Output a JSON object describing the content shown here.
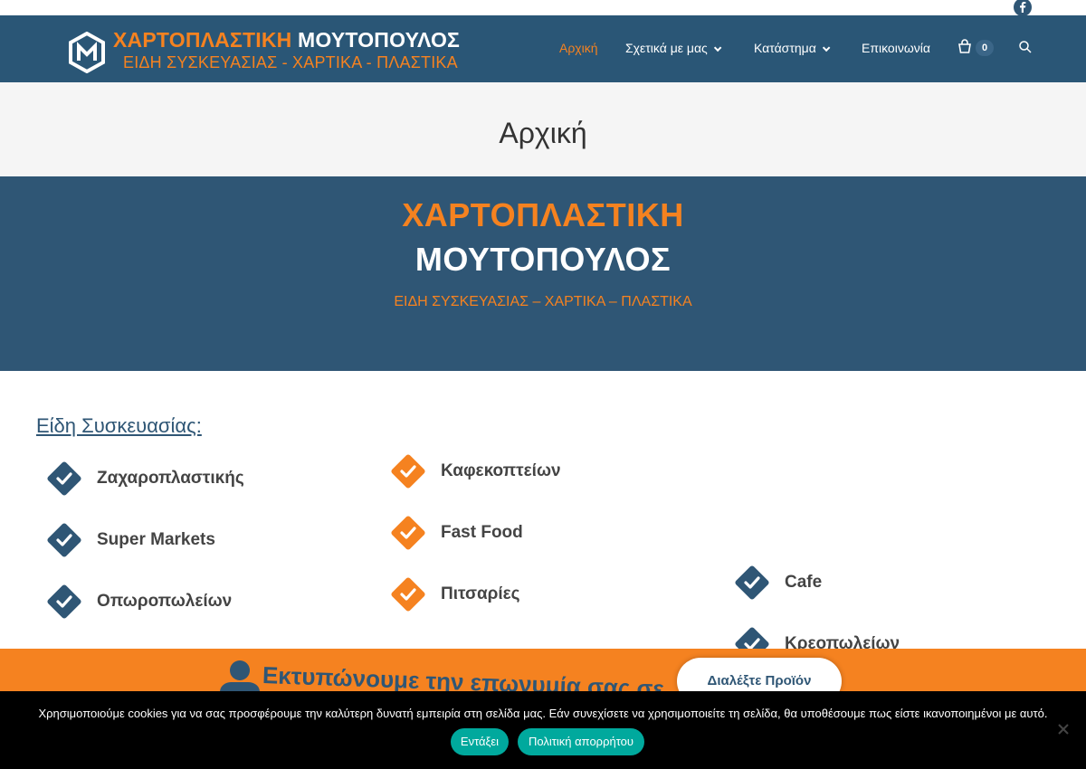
{
  "brand": {
    "name_orange": "ΧΑΡΤΟΠΛΑΣΤΙΚΗ",
    "name_white": "ΜΟΥΤΟΠΟΥΛΟΣ",
    "tagline": "ΕΙΔΗ ΣΥΣΚΕΥΑΣΙΑΣ - ΧΑΡΤΙΚΑ - ΠΛΑΣΤΙΚΑ"
  },
  "nav": {
    "home": "Αρχική",
    "about": "Σχετικά με μας",
    "shop": "Κατάστημα",
    "contact": "Επικοινωνία",
    "cart_count": "0"
  },
  "page_title": "Αρχική",
  "hero": {
    "line1": "ΧΑΡΤΟΠΛΑΣΤΙΚΗ",
    "line2": "ΜΟΥΤΟΠΟΥΛΟΣ",
    "subtitle": "ΕΙΔΗ ΣΥΣΚΕΥΑΣΙΑΣ – ΧΑΡΤΙΚΑ – ΠΛΑΣΤΙΚΑ"
  },
  "section": {
    "title": "Είδη Συσκευασίας:",
    "items": [
      {
        "label": "Ζαχαροπλαστικής",
        "color": "#2f5675"
      },
      {
        "label": "Super Markets",
        "color": "#2f5675"
      },
      {
        "label": "Οπωροπωλείων",
        "color": "#2f5675"
      },
      {
        "label": "Καφεκοπτείων",
        "color": "#f58220"
      },
      {
        "label": "Fast Food",
        "color": "#f58220"
      },
      {
        "label": "Πιτσαρίες",
        "color": "#f58220"
      },
      {
        "label": "Cafe",
        "color": "#2f5675"
      },
      {
        "label": "Κρεοπωλείων",
        "color": "#2f5675"
      }
    ]
  },
  "banner": {
    "text": "Εκτυπώνουμε την επωνυμία σας σε",
    "button": "Διαλέξτε Προϊόν"
  },
  "cookie": {
    "text": "Χρησιμοποιούμε cookies για να σας προσφέρουμε την καλύτερη δυνατή εμπειρία στη σελίδα μας. Εάν συνεχίσετε να χρησιμοποιείτε τη σελίδα, θα υποθέσουμε πως είστε ικανοποιημένοι με αυτό.",
    "accept": "Εντάξει",
    "policy": "Πολιτική απορρήτου"
  },
  "colors": {
    "primary": "#2f5675",
    "accent": "#f58220",
    "cookie_button": "#00a99d"
  },
  "icons": [
    "facebook-icon",
    "logo-icon",
    "chevron-down-icon",
    "cart-icon",
    "search-icon",
    "check-diamond-icon",
    "close-icon"
  ]
}
